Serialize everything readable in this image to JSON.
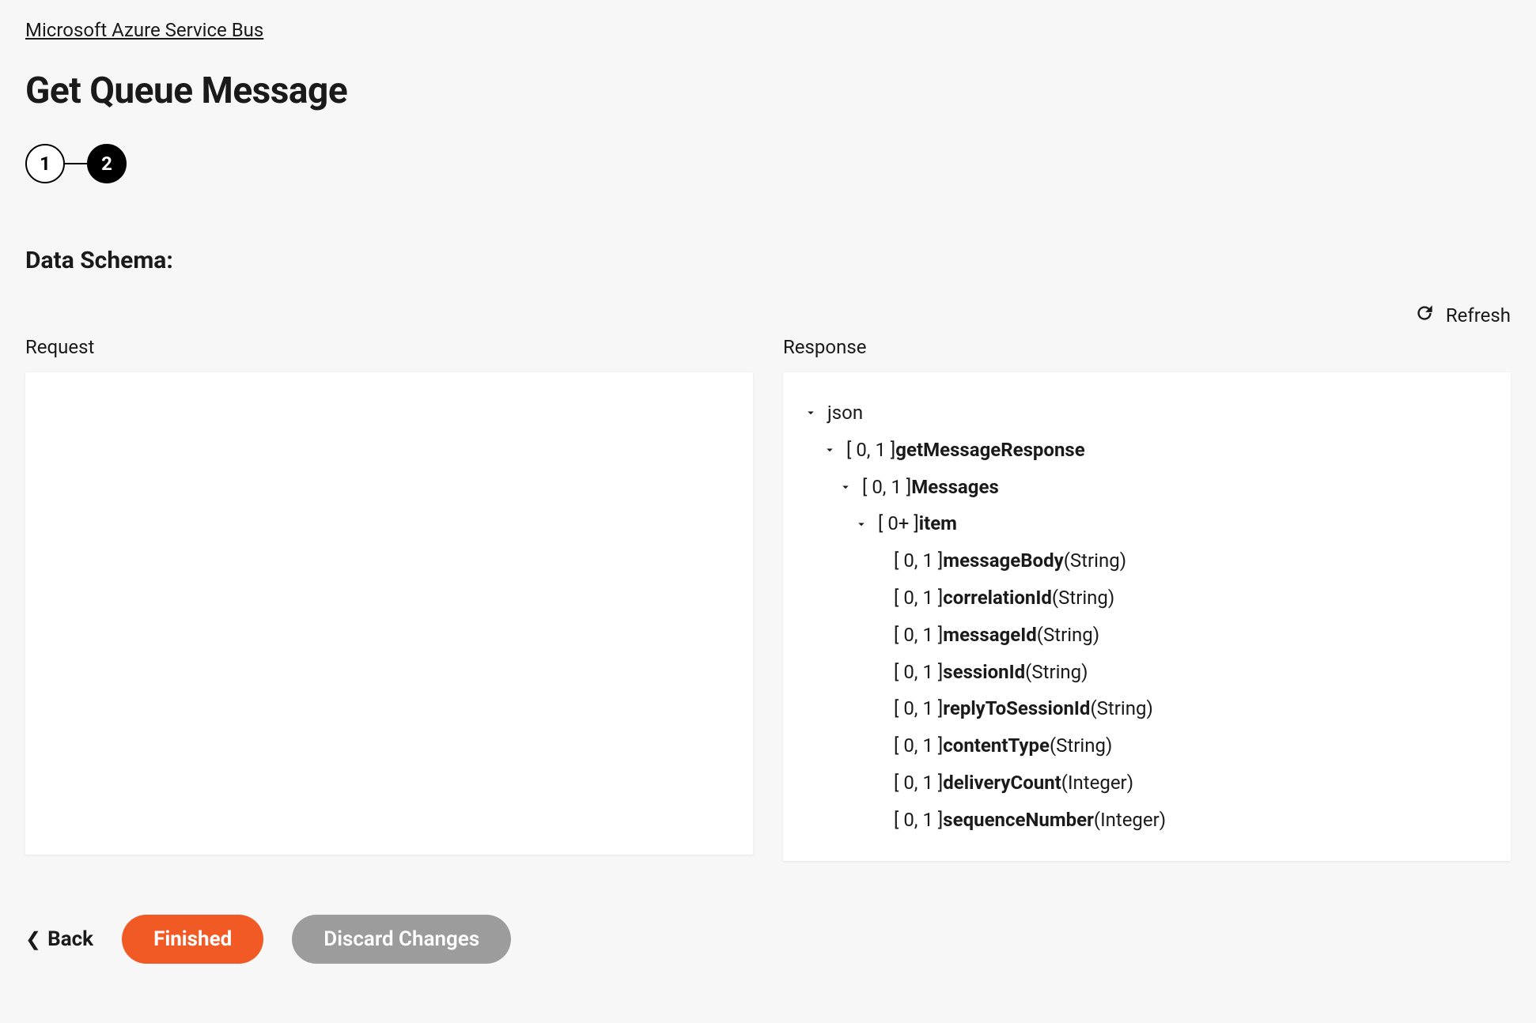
{
  "breadcrumb": "Microsoft Azure Service Bus",
  "title": "Get Queue Message",
  "stepper": {
    "step1": "1",
    "step2": "2"
  },
  "schema": {
    "heading": "Data Schema:",
    "refresh": "Refresh",
    "request": {
      "label": "Request"
    },
    "response": {
      "label": "Response",
      "tree": {
        "root": {
          "label": "json"
        },
        "n1": {
          "card": "[ 0, 1 ] ",
          "name": "getMessageResponse"
        },
        "n2": {
          "card": "[ 0, 1 ] ",
          "name": "Messages"
        },
        "n3": {
          "card": "[ 0+ ] ",
          "name": "item"
        },
        "leaves": [
          {
            "card": "[ 0, 1 ] ",
            "name": "messageBody",
            "type": " (String)"
          },
          {
            "card": "[ 0, 1 ] ",
            "name": "correlationId",
            "type": " (String)"
          },
          {
            "card": "[ 0, 1 ] ",
            "name": "messageId",
            "type": " (String)"
          },
          {
            "card": "[ 0, 1 ] ",
            "name": "sessionId",
            "type": " (String)"
          },
          {
            "card": "[ 0, 1 ] ",
            "name": "replyToSessionId",
            "type": " (String)"
          },
          {
            "card": "[ 0, 1 ] ",
            "name": "contentType",
            "type": " (String)"
          },
          {
            "card": "[ 0, 1 ] ",
            "name": "deliveryCount",
            "type": " (Integer)"
          },
          {
            "card": "[ 0, 1 ] ",
            "name": "sequenceNumber",
            "type": " (Integer)"
          }
        ]
      }
    }
  },
  "footer": {
    "back": "Back",
    "finished": "Finished",
    "discard": "Discard Changes"
  }
}
